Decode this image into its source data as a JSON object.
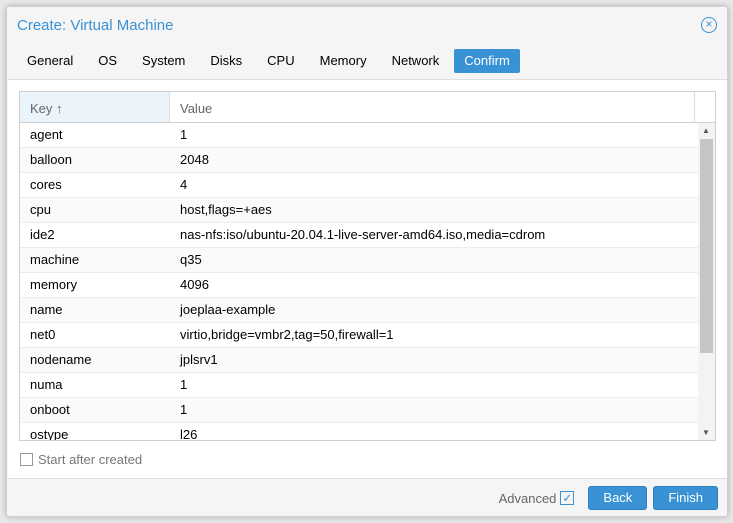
{
  "window": {
    "title": "Create: Virtual Machine"
  },
  "tabs": [
    {
      "label": "General"
    },
    {
      "label": "OS"
    },
    {
      "label": "System"
    },
    {
      "label": "Disks"
    },
    {
      "label": "CPU"
    },
    {
      "label": "Memory"
    },
    {
      "label": "Network"
    },
    {
      "label": "Confirm",
      "active": true
    }
  ],
  "grid": {
    "columns": {
      "key": "Key",
      "value": "Value"
    },
    "sort_icon": "↑",
    "rows": [
      {
        "k": "agent",
        "v": "1"
      },
      {
        "k": "balloon",
        "v": "2048"
      },
      {
        "k": "cores",
        "v": "4"
      },
      {
        "k": "cpu",
        "v": "host,flags=+aes"
      },
      {
        "k": "ide2",
        "v": "nas-nfs:iso/ubuntu-20.04.1-live-server-amd64.iso,media=cdrom"
      },
      {
        "k": "machine",
        "v": "q35"
      },
      {
        "k": "memory",
        "v": "4096"
      },
      {
        "k": "name",
        "v": "joeplaa-example"
      },
      {
        "k": "net0",
        "v": "virtio,bridge=vmbr2,tag=50,firewall=1"
      },
      {
        "k": "nodename",
        "v": "jplsrv1"
      },
      {
        "k": "numa",
        "v": "1"
      },
      {
        "k": "onboot",
        "v": "1"
      },
      {
        "k": "ostype",
        "v": "l26"
      }
    ]
  },
  "start_after_created": {
    "label": "Start after created",
    "checked": false
  },
  "footer": {
    "advanced": "Advanced",
    "advanced_checked": true,
    "back": "Back",
    "finish": "Finish"
  },
  "colors": {
    "accent": "#3892d4"
  }
}
